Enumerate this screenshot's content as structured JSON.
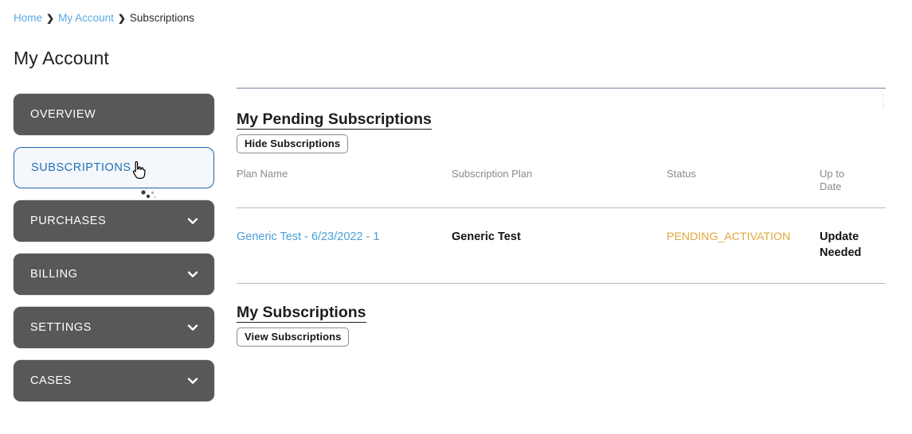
{
  "breadcrumb": {
    "separator": "›",
    "items": [
      {
        "label": "Home",
        "type": "link"
      },
      {
        "label": "My Account",
        "type": "link"
      },
      {
        "label": "Subscriptions",
        "type": "current"
      }
    ]
  },
  "page": {
    "title": "My Account"
  },
  "sidebar": {
    "items": [
      {
        "label": "OVERVIEW",
        "state": "default",
        "expandable": false,
        "icon": ""
      },
      {
        "label": "SUBSCRIPTIONS",
        "state": "active",
        "expandable": false,
        "icon": ""
      },
      {
        "label": "PURCHASES",
        "state": "default",
        "expandable": true,
        "icon": "chevron-down-icon"
      },
      {
        "label": "BILLING",
        "state": "default",
        "expandable": true,
        "icon": "chevron-down-icon"
      },
      {
        "label": "SETTINGS",
        "state": "default",
        "expandable": true,
        "icon": "chevron-down-icon"
      },
      {
        "label": "CASES",
        "state": "default",
        "expandable": true,
        "icon": "chevron-down-icon"
      }
    ]
  },
  "cursor": {
    "icon": "hand-pointer-cursor",
    "click_indicator": "click-ripple-icon"
  },
  "pending_section": {
    "heading": "My Pending Subscriptions",
    "toggle_button": "Hide Subscriptions",
    "columns": [
      "Plan Name",
      "Subscription Plan",
      "Status",
      "Up to\nDate"
    ],
    "rows": [
      {
        "plan_name": "Generic Test - 6/23/2022 - 1",
        "subscription_plan": "Generic Test",
        "status": "PENDING_ACTIVATION",
        "up_to_date": "Update Needed"
      }
    ]
  },
  "subscriptions_section": {
    "heading": "My Subscriptions",
    "toggle_button": "View Subscriptions"
  },
  "colors": {
    "sidebar_bg": "#58585a",
    "sidebar_active_border": "#1d64ab",
    "sidebar_active_text": "#2272b8",
    "link_blue": "#4a9fd8",
    "breadcrumb_link": "#5aa9e0",
    "status_pending": "#e0a63a",
    "divider": "#b9bacb"
  }
}
